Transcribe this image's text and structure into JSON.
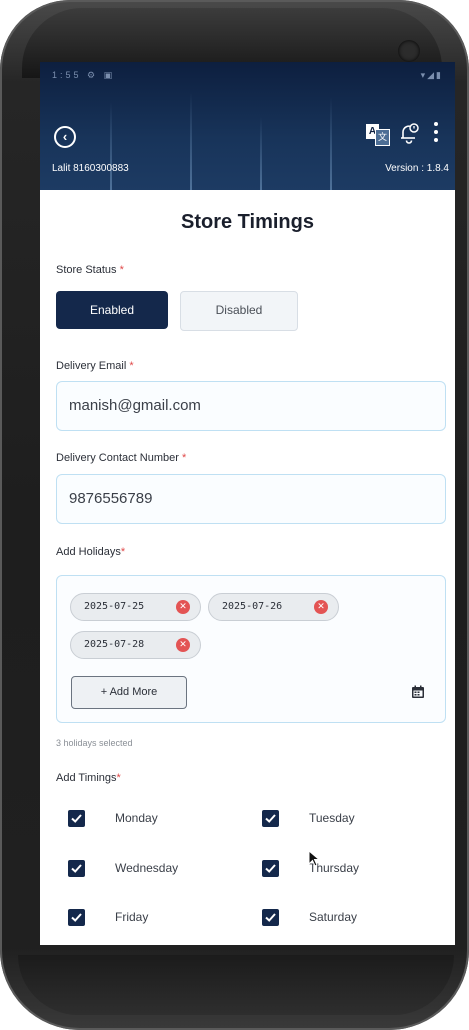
{
  "header": {
    "status_left": "1:55 ⚙ ▣",
    "status_right": "▾◢▮",
    "user": "Lalit 8160300883",
    "version": "Version : 1.8.4",
    "icons": [
      "back-circle-icon",
      "translate-icon",
      "notification-bell-icon",
      "more-vertical-icon"
    ]
  },
  "page": {
    "title": "Store Timings"
  },
  "store_status": {
    "label": "Store Status",
    "required_mark": "*",
    "options": [
      "Enabled",
      "Disabled"
    ],
    "selected": "Enabled"
  },
  "delivery_email": {
    "label": "Delivery Email",
    "required_mark": "*",
    "value": "manish@gmail.com"
  },
  "delivery_contact": {
    "label": "Delivery Contact Number",
    "required_mark": "*",
    "value": "9876556789"
  },
  "holidays": {
    "label": "Add Holidays",
    "required_mark": "*",
    "dates": [
      "2025-07-25",
      "2025-07-26",
      "2025-07-28"
    ],
    "add_more": "+ Add More",
    "summary": "3 holidays selected"
  },
  "timings": {
    "label": "Add Timings",
    "required_mark": "*",
    "days": [
      {
        "name": "Monday",
        "checked": true
      },
      {
        "name": "Tuesday",
        "checked": true
      },
      {
        "name": "Wednesday",
        "checked": true
      },
      {
        "name": "Thursday",
        "checked": true
      },
      {
        "name": "Friday",
        "checked": true
      },
      {
        "name": "Saturday",
        "checked": true
      }
    ]
  },
  "colors": {
    "primary": "#14284b",
    "required": "#e04848",
    "chip_remove": "#e35454",
    "field_border": "#bfe0f3"
  }
}
